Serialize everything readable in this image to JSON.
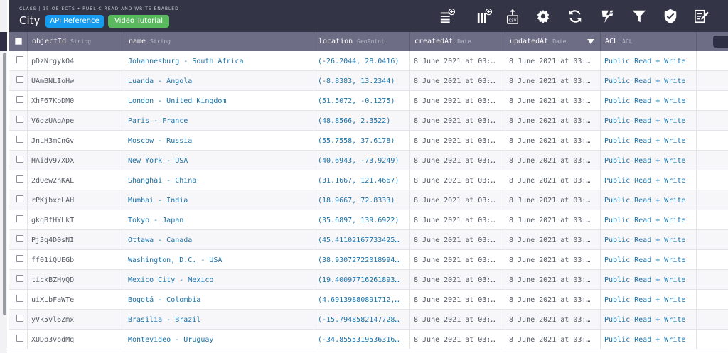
{
  "header": {
    "subtitle": "CLASS | 15 OBJECTS • PUBLIC READ AND WRITE ENABLED",
    "class_name": "City",
    "api_reference_label": "API Reference",
    "video_tutorial_label": "Video Tutorial"
  },
  "toolbar": {
    "icons": [
      "add-row-icon",
      "add-column-icon",
      "export-csv-icon",
      "gear-icon",
      "refresh-icon",
      "lightning-icon",
      "filter-icon",
      "shield-icon",
      "edit-icon"
    ],
    "export_label": "CSV"
  },
  "columns": [
    {
      "name": "objectId",
      "type": "String"
    },
    {
      "name": "name",
      "type": "String"
    },
    {
      "name": "location",
      "type": "GeoPoint"
    },
    {
      "name": "createdAt",
      "type": "Date"
    },
    {
      "name": "updatedAt",
      "type": "Date"
    },
    {
      "name": "ACL",
      "type": "ACL"
    }
  ],
  "rows": [
    {
      "objectId": "pDzNrgykO4",
      "name": "Johannesburg - South Africa",
      "location": "(-26.2044, 28.0416)",
      "createdAt": "8 June 2021 at 03:…",
      "updatedAt": "8 June 2021 at 03:…",
      "acl": "Public Read + Write"
    },
    {
      "objectId": "UAmBNLIoHw",
      "name": "Luanda - Angola",
      "location": "(-8.8383, 13.2344)",
      "createdAt": "8 June 2021 at 03:…",
      "updatedAt": "8 June 2021 at 03:…",
      "acl": "Public Read + Write"
    },
    {
      "objectId": "XhF67KbDM0",
      "name": "London - United Kingdom",
      "location": "(51.5072, -0.1275)",
      "createdAt": "8 June 2021 at 03:…",
      "updatedAt": "8 June 2021 at 03:…",
      "acl": "Public Read + Write"
    },
    {
      "objectId": "V6gzUAgApe",
      "name": "Paris - France",
      "location": "(48.8566, 2.3522)",
      "createdAt": "8 June 2021 at 03:…",
      "updatedAt": "8 June 2021 at 03:…",
      "acl": "Public Read + Write"
    },
    {
      "objectId": "JnLH3mCnGv",
      "name": "Moscow - Russia",
      "location": "(55.7558, 37.6178)",
      "createdAt": "8 June 2021 at 03:…",
      "updatedAt": "8 June 2021 at 03:…",
      "acl": "Public Read + Write"
    },
    {
      "objectId": "HAidv97XDX",
      "name": "New York - USA",
      "location": "(40.6943, -73.9249)",
      "createdAt": "8 June 2021 at 03:…",
      "updatedAt": "8 June 2021 at 03:…",
      "acl": "Public Read + Write"
    },
    {
      "objectId": "2dQew2hKAL",
      "name": "Shanghai - China",
      "location": "(31.1667, 121.4667)",
      "createdAt": "8 June 2021 at 03:…",
      "updatedAt": "8 June 2021 at 03:…",
      "acl": "Public Read + Write"
    },
    {
      "objectId": "rPKjbxcLAH",
      "name": "Mumbai - India",
      "location": "(18.9667, 72.8333)",
      "createdAt": "8 June 2021 at 03:…",
      "updatedAt": "8 June 2021 at 03:…",
      "acl": "Public Read + Write"
    },
    {
      "objectId": "gkqBfHYLkT",
      "name": "Tokyo - Japan",
      "location": "(35.6897, 139.6922)",
      "createdAt": "8 June 2021 at 03:…",
      "updatedAt": "8 June 2021 at 03:…",
      "acl": "Public Read + Write"
    },
    {
      "objectId": "Pj3q4D0sNI",
      "name": "Ottawa - Canada",
      "location": "(45.41102167733425…",
      "createdAt": "8 June 2021 at 03:…",
      "updatedAt": "8 June 2021 at 03:…",
      "acl": "Public Read + Write"
    },
    {
      "objectId": "ff01iQUEGb",
      "name": "Washington, D.C. - USA",
      "location": "(38.93072722018994…",
      "createdAt": "8 June 2021 at 03:…",
      "updatedAt": "8 June 2021 at 03:…",
      "acl": "Public Read + Write"
    },
    {
      "objectId": "tickBZHyQD",
      "name": "Mexico City - Mexico",
      "location": "(19.40097716261893…",
      "createdAt": "8 June 2021 at 03:…",
      "updatedAt": "8 June 2021 at 03:…",
      "acl": "Public Read + Write"
    },
    {
      "objectId": "uiXLbFaWTe",
      "name": "Bogotá - Colombia",
      "location": "(4.69139880891712,…",
      "createdAt": "8 June 2021 at 03:…",
      "updatedAt": "8 June 2021 at 03:…",
      "acl": "Public Read + Write"
    },
    {
      "objectId": "yVk5vl6Zmx",
      "name": "Brasilia - Brazil",
      "location": "(-15.7948582147728…",
      "createdAt": "8 June 2021 at 03:…",
      "updatedAt": "8 June 2021 at 03:…",
      "acl": "Public Read + Write"
    },
    {
      "objectId": "XUDp3vodMq",
      "name": "Montevideo - Uruguay",
      "location": "(-34.8555319536316…",
      "createdAt": "8 June 2021 at 03:…",
      "updatedAt": "8 June 2021 at 03:…",
      "acl": "Public Read + Write"
    }
  ]
}
